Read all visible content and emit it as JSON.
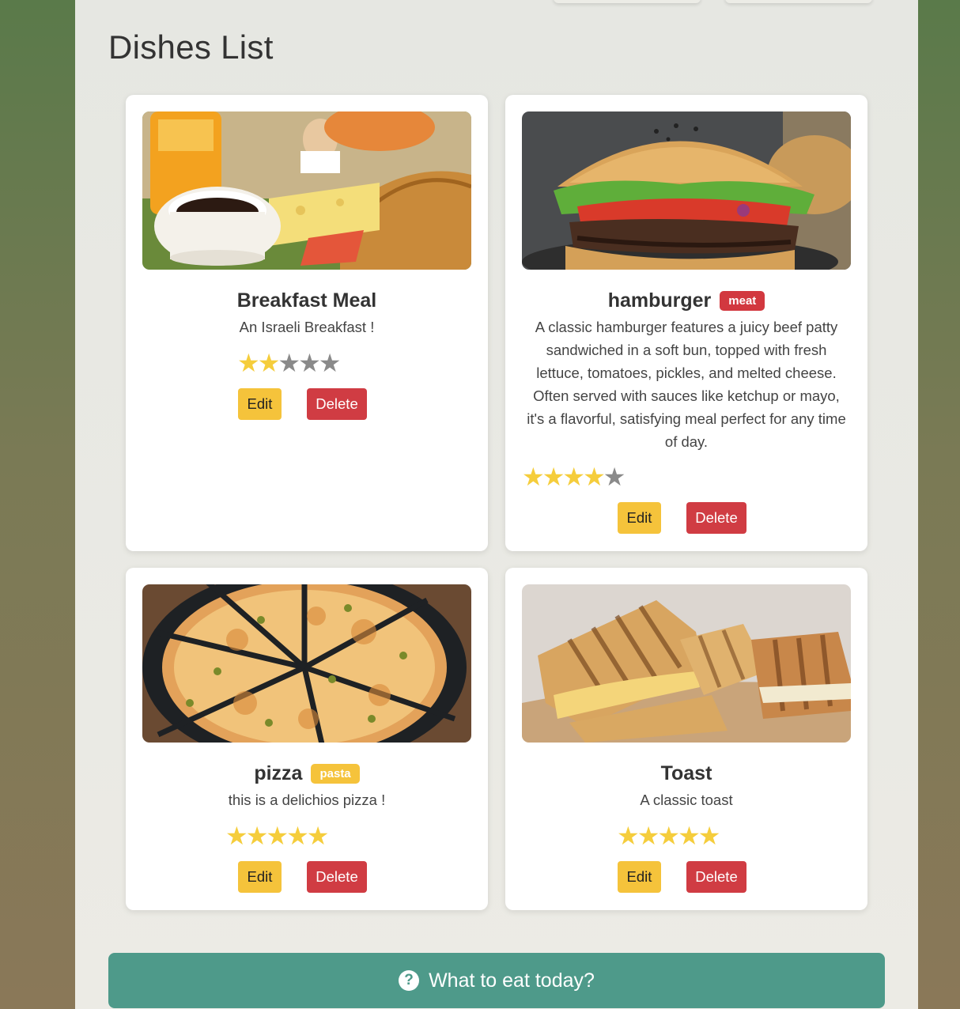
{
  "page": {
    "title": "Dishes List"
  },
  "dishes": [
    {
      "name": "Breakfast Meal",
      "tag": "",
      "description": "An Israeli Breakfast !",
      "rating": 2,
      "max_rating": 5,
      "image": "breakfast-photo"
    },
    {
      "name": "hamburger",
      "tag": "meat",
      "tag_color": "#d2383f",
      "description": "A classic hamburger features a juicy beef patty sandwiched in a soft bun, topped with fresh lettuce, tomatoes, pickles, and melted cheese. Often served with sauces like ketchup or mayo, it's a flavorful, satisfying meal perfect for any time of day.",
      "rating": 4,
      "max_rating": 5,
      "image": "hamburger-photo"
    },
    {
      "name": "pizza",
      "tag": "pasta",
      "tag_color": "#f5c33b",
      "description": "this is a delichios pizza !",
      "rating": 5,
      "max_rating": 5,
      "image": "pizza-photo"
    },
    {
      "name": "Toast",
      "tag": "",
      "description": "A classic toast",
      "rating": 5,
      "max_rating": 5,
      "image": "toast-photo"
    }
  ],
  "buttons": {
    "edit": "Edit",
    "delete": "Delete"
  },
  "cta": {
    "label": "What to eat today?",
    "icon": "question-circle-icon"
  },
  "colors": {
    "edit": "#f5c33b",
    "delete": "#d03c43",
    "cta": "#4e9a8a",
    "star_on": "#f5cd3c",
    "star_off": "#8a8a8a"
  }
}
